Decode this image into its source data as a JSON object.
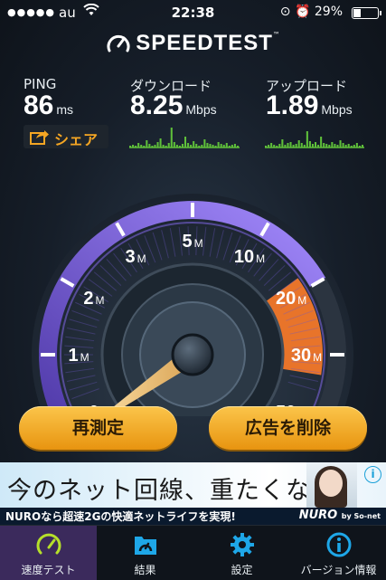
{
  "status_bar": {
    "signal_dots": "●●●●●",
    "carrier": "au",
    "time": "22:38",
    "battery": "29%",
    "battery_level": 0.29
  },
  "app": {
    "title": "SPEEDTEST",
    "trademark": "™"
  },
  "stats": {
    "ping": {
      "label": "PING",
      "value": "86",
      "unit": "ms"
    },
    "download": {
      "label": "ダウンロード",
      "value": "8.25",
      "unit": "Mbps"
    },
    "upload": {
      "label": "アップロード",
      "value": "1.89",
      "unit": "Mbps"
    }
  },
  "share_label": "シェア",
  "gauge": {
    "ticks": [
      {
        "num": "0",
        "unit": ""
      },
      {
        "num": "1",
        "unit": "M"
      },
      {
        "num": "2",
        "unit": "M"
      },
      {
        "num": "3",
        "unit": "M"
      },
      {
        "num": "5",
        "unit": "M"
      },
      {
        "num": "10",
        "unit": "M"
      },
      {
        "num": "20",
        "unit": "M"
      },
      {
        "num": "30",
        "unit": "M"
      },
      {
        "num": "50",
        "unit": "M"
      }
    ]
  },
  "buttons": {
    "retest": "再測定",
    "remove_ads": "広告を削除"
  },
  "ad": {
    "headline": "今のネット回線、重たくない?",
    "subtext": "NUROなら超速2Gの快適ネットライフを実現!",
    "brand": "NURO",
    "brand_suffix": "by So-net",
    "info": "i"
  },
  "tabs": [
    {
      "label": "速度テスト",
      "icon": "speedometer-icon"
    },
    {
      "label": "結果",
      "icon": "results-icon"
    },
    {
      "label": "設定",
      "icon": "gear-icon"
    },
    {
      "label": "バージョン情報",
      "icon": "info-icon"
    }
  ],
  "colors": {
    "accent_orange": "#f5a623",
    "graph_green": "#5fbf3a",
    "gauge_purple": "#8a6cf0",
    "gauge_orange": "#e8742a",
    "active_tab": "#3b2a5c",
    "speed_icon_green": "#b6e02a",
    "tab_icon_blue": "#1ea7e8"
  }
}
